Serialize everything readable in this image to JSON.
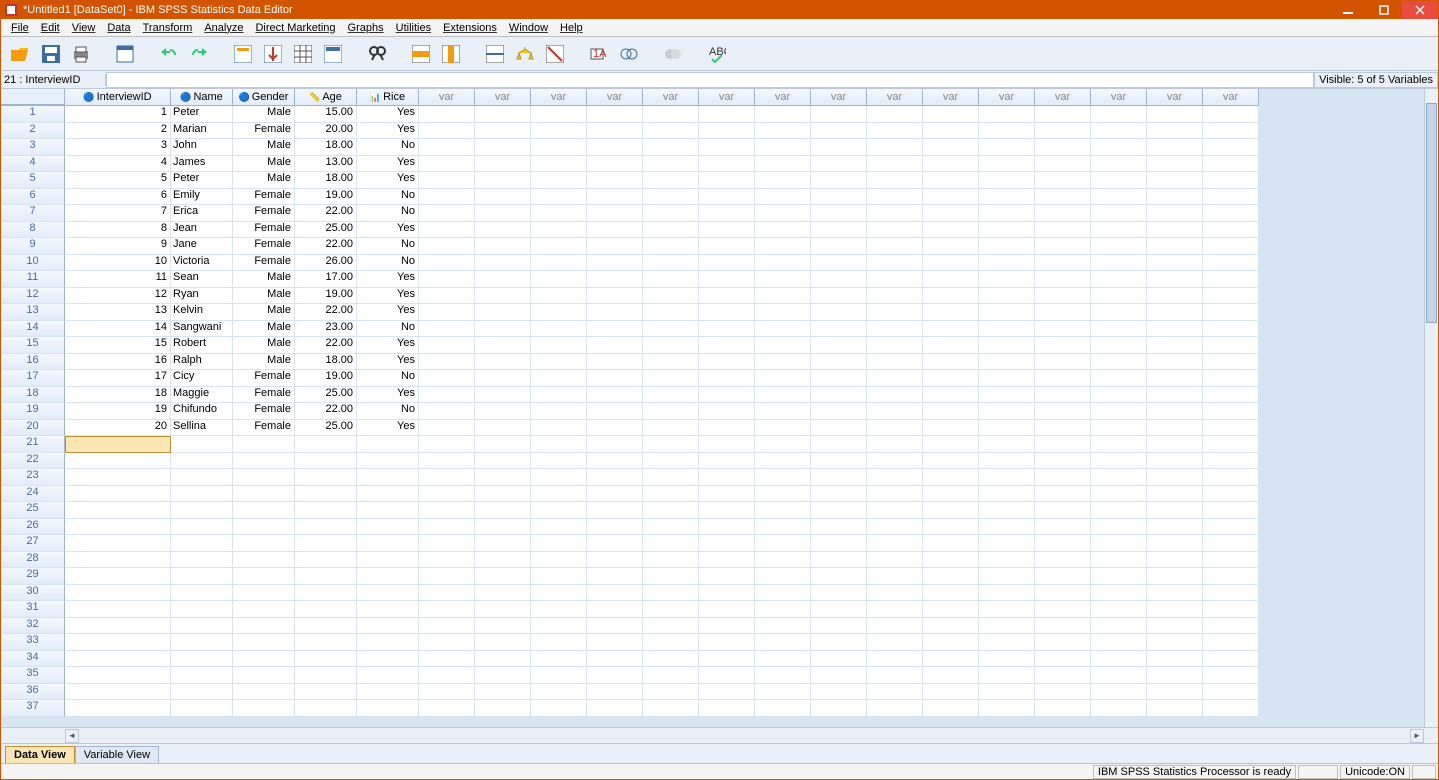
{
  "window": {
    "title": "*Untitled1 [DataSet0] - IBM SPSS Statistics Data Editor"
  },
  "menus": [
    "File",
    "Edit",
    "View",
    "Data",
    "Transform",
    "Analyze",
    "Direct Marketing",
    "Graphs",
    "Utilities",
    "Extensions",
    "Window",
    "Help"
  ],
  "location": {
    "cell_ref": "21 : InterviewID",
    "cell_value": ""
  },
  "visible_label": "Visible: 5 of 5 Variables",
  "columns": [
    {
      "name": "InterviewID",
      "width": "w-id",
      "icon": "🔵"
    },
    {
      "name": "Name",
      "width": "w-name",
      "icon": "🔵"
    },
    {
      "name": "Gender",
      "width": "w-gen",
      "icon": "🔵"
    },
    {
      "name": "Age",
      "width": "w-age",
      "icon": "📏"
    },
    {
      "name": "Rice",
      "width": "w-rice",
      "icon": "📊"
    }
  ],
  "var_cols": 15,
  "var_label": "var",
  "selected_cell": {
    "row": 21,
    "col": 0
  },
  "rows": [
    {
      "n": 1,
      "id": "1",
      "name": "Peter",
      "gender": "Male",
      "age": "15.00",
      "rice": "Yes"
    },
    {
      "n": 2,
      "id": "2",
      "name": "Marian",
      "gender": "Female",
      "age": "20.00",
      "rice": "Yes"
    },
    {
      "n": 3,
      "id": "3",
      "name": "John",
      "gender": "Male",
      "age": "18.00",
      "rice": "No"
    },
    {
      "n": 4,
      "id": "4",
      "name": "James",
      "gender": "Male",
      "age": "13.00",
      "rice": "Yes"
    },
    {
      "n": 5,
      "id": "5",
      "name": "Peter",
      "gender": "Male",
      "age": "18.00",
      "rice": "Yes"
    },
    {
      "n": 6,
      "id": "6",
      "name": "Emily",
      "gender": "Female",
      "age": "19.00",
      "rice": "No"
    },
    {
      "n": 7,
      "id": "7",
      "name": "Erica",
      "gender": "Female",
      "age": "22.00",
      "rice": "No"
    },
    {
      "n": 8,
      "id": "8",
      "name": "Jean",
      "gender": "Female",
      "age": "25.00",
      "rice": "Yes"
    },
    {
      "n": 9,
      "id": "9",
      "name": "Jane",
      "gender": "Female",
      "age": "22.00",
      "rice": "No"
    },
    {
      "n": 10,
      "id": "10",
      "name": "Victoria",
      "gender": "Female",
      "age": "26.00",
      "rice": "No"
    },
    {
      "n": 11,
      "id": "11",
      "name": "Sean",
      "gender": "Male",
      "age": "17.00",
      "rice": "Yes"
    },
    {
      "n": 12,
      "id": "12",
      "name": "Ryan",
      "gender": "Male",
      "age": "19.00",
      "rice": "Yes"
    },
    {
      "n": 13,
      "id": "13",
      "name": "Kelvin",
      "gender": "Male",
      "age": "22.00",
      "rice": "Yes"
    },
    {
      "n": 14,
      "id": "14",
      "name": "Sangwani",
      "gender": "Male",
      "age": "23.00",
      "rice": "No"
    },
    {
      "n": 15,
      "id": "15",
      "name": "Robert",
      "gender": "Male",
      "age": "22.00",
      "rice": "Yes"
    },
    {
      "n": 16,
      "id": "16",
      "name": "Ralph",
      "gender": "Male",
      "age": "18.00",
      "rice": "Yes"
    },
    {
      "n": 17,
      "id": "17",
      "name": "Cicy",
      "gender": "Female",
      "age": "19.00",
      "rice": "No"
    },
    {
      "n": 18,
      "id": "18",
      "name": "Maggie",
      "gender": "Female",
      "age": "25.00",
      "rice": "Yes"
    },
    {
      "n": 19,
      "id": "19",
      "name": "Chifundo",
      "gender": "Female",
      "age": "22.00",
      "rice": "No"
    },
    {
      "n": 20,
      "id": "20",
      "name": "Sellina",
      "gender": "Female",
      "age": "25.00",
      "rice": "Yes"
    }
  ],
  "empty_rows_from": 21,
  "empty_rows_to": 37,
  "tabs": {
    "data": "Data View",
    "var": "Variable View"
  },
  "status": {
    "processor": "IBM SPSS Statistics Processor is ready",
    "unicode": "Unicode:ON"
  }
}
